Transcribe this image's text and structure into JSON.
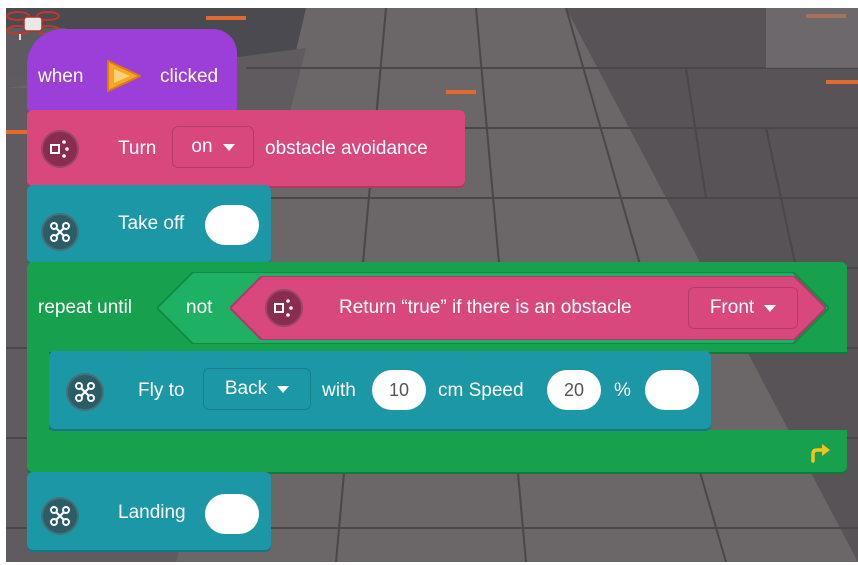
{
  "hat_block": {
    "when_label": "when",
    "clicked_label": "clicked",
    "icon": "play-flag-icon"
  },
  "obstacle_block": {
    "turn_label": "Turn",
    "toggle_value": "on",
    "suffix_label": "obstacle avoidance",
    "icon": "sensor-icon"
  },
  "takeoff_block": {
    "label": "Take off",
    "icon": "drone-icon"
  },
  "repeat_block": {
    "label": "repeat until",
    "not_label": "not",
    "condition_label": "Return “true” if there is an obstacle",
    "direction_value": "Front",
    "loop_icon": "loop-arrow-icon"
  },
  "fly_block": {
    "fly_label": "Fly to",
    "direction_value": "Back",
    "with_label": "with",
    "distance_value": "10",
    "unit_label": "cm Speed",
    "speed_value": "20",
    "percent_label": "%",
    "icon": "drone-icon"
  },
  "landing_block": {
    "label": "Landing",
    "icon": "drone-icon"
  },
  "colors": {
    "event": "#9b3fd8",
    "sensor": "#d8487d",
    "motion": "#1c97a6",
    "control": "#17a04e"
  }
}
